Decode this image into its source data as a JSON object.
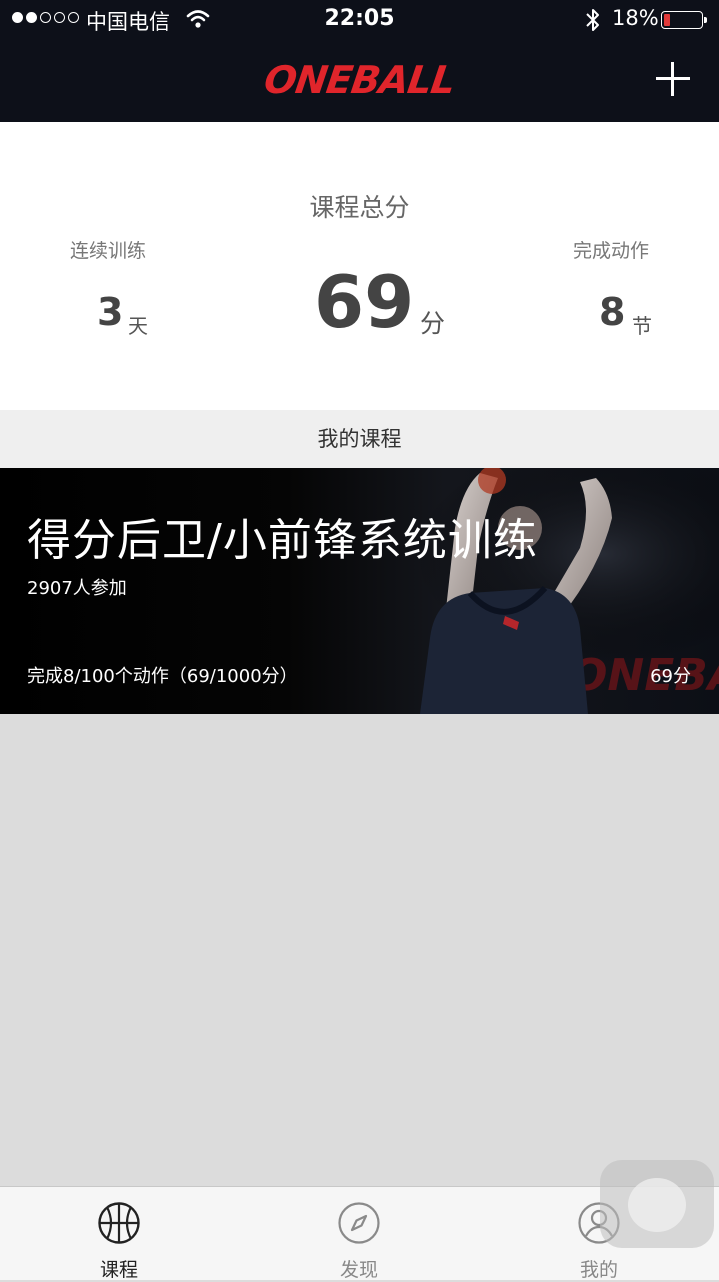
{
  "status_bar": {
    "carrier": "中国电信",
    "time": "22:05",
    "battery_percent": "18%",
    "battery_level": 0.18,
    "signal_bars_filled": 2,
    "signal_bars_total": 5
  },
  "nav": {
    "logo_text": "ONEBALL",
    "add_icon": "plus-icon",
    "brand_color": "#e0252b"
  },
  "summary": {
    "title": "课程总分",
    "total_score": "69",
    "total_score_unit": "分",
    "streak_label": "连续训练",
    "streak_value": "3",
    "streak_unit": "天",
    "completed_label": "完成动作",
    "completed_value": "8",
    "completed_unit": "节"
  },
  "section": {
    "my_courses_label": "我的课程"
  },
  "course": {
    "title": "得分后卫/小前锋系统训练",
    "participants": "2907人参加",
    "progress": "完成8/100个动作（69/1000分）",
    "score": "69分"
  },
  "tabbar": {
    "tabs": [
      {
        "label": "课程",
        "icon": "basketball-icon",
        "active": true
      },
      {
        "label": "发现",
        "icon": "compass-icon",
        "active": false
      },
      {
        "label": "我的",
        "icon": "profile-icon",
        "active": false
      }
    ]
  }
}
